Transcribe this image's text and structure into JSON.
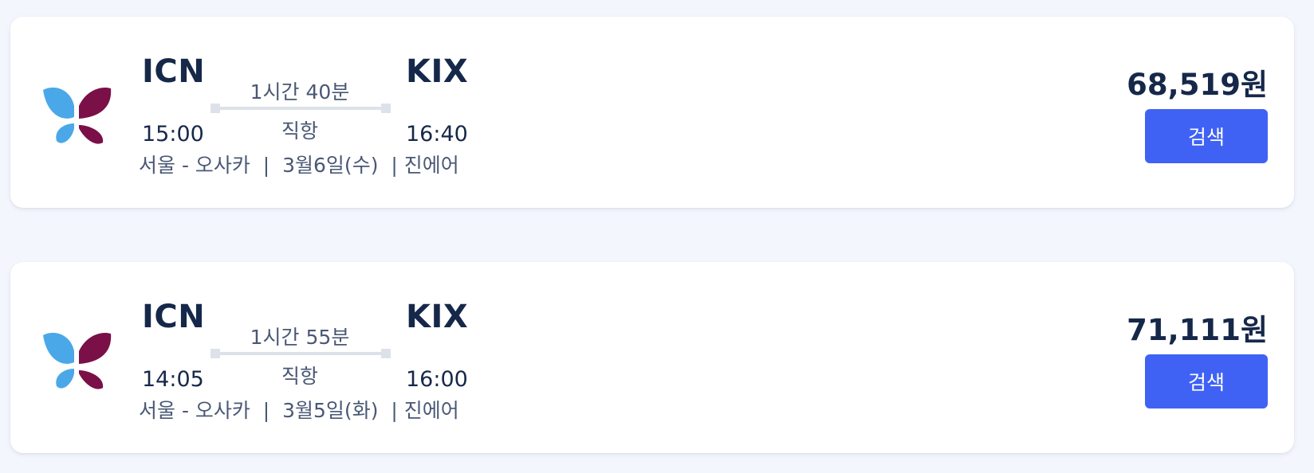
{
  "flights": [
    {
      "airline_logo_icon": "butterfly-logo-icon",
      "departure_airport": "ICN",
      "departure_time": "15:00",
      "arrival_airport": "KIX",
      "arrival_time": "16:40",
      "duration": "1시간 40분",
      "stops": "직항",
      "details": "서울 - 오사카  |  3월6일(수)  | 진에어",
      "price": "68,519원",
      "button_label": "검색"
    },
    {
      "airline_logo_icon": "butterfly-logo-icon",
      "departure_airport": "ICN",
      "departure_time": "14:05",
      "arrival_airport": "KIX",
      "arrival_time": "16:00",
      "duration": "1시간 55분",
      "stops": "직항",
      "details": "서울 - 오사카  |  3월5일(화)  | 진에어",
      "price": "71,111원",
      "button_label": "검색"
    }
  ],
  "colors": {
    "page_background": "#f3f6fc",
    "card_background": "#ffffff",
    "primary_text": "#16284a",
    "secondary_text": "#4a5875",
    "button": "#3f62f5",
    "logo_blue": "#4aa8e8",
    "logo_purple": "#7a1047"
  }
}
